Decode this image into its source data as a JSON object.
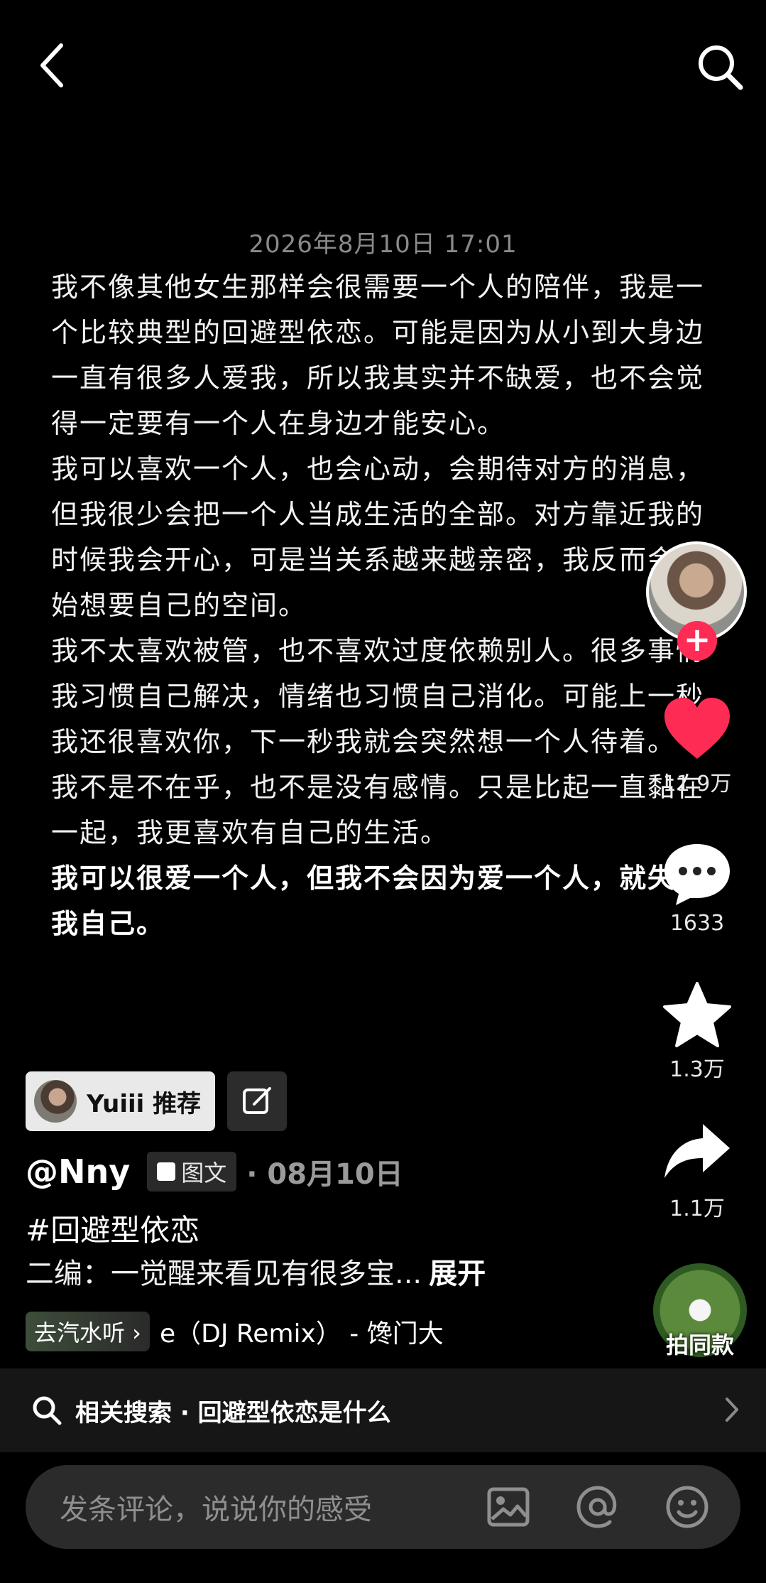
{
  "nav": {
    "back_icon": "chevron-left-icon",
    "search_icon": "search-icon"
  },
  "post": {
    "timestamp": "2026年8月10日 17:01",
    "paragraphs": [
      "我不像其他女生那样会很需要一个人的陪伴，我是一个比较典型的回避型依恋。可能是因为从小到大身边一直有很多人爱我，所以我其实并不缺爱，也不会觉得一定要有一个人在身边才能安心。",
      "我可以喜欢一个人，也会心动，会期待对方的消息，但我很少会把一个人当成生活的全部。对方靠近我的时候我会开心，可是当关系越来越亲密，我反而会开始想要自己的空间。",
      "我不太喜欢被管，也不喜欢过度依赖别人。很多事情我习惯自己解决，情绪也习惯自己消化。可能上一秒我还很喜欢你，下一秒我就会突然想一个人待着。",
      "我不是不在乎，也不是没有感情。只是比起一直黏在一起，我更喜欢有自己的生活。",
      "我可以很爱一个人，但我不会因为爱一个人，就失去我自己。"
    ]
  },
  "actions": {
    "follow_plus": "+",
    "likes": "11.9万",
    "comments": "1633",
    "favorites": "1.3万",
    "shares": "1.1万",
    "like_color": "#fe2c55"
  },
  "recommend": {
    "label": "Yuiii 推荐"
  },
  "author": {
    "username": "@Nny",
    "type_tag": "图文",
    "date": "· 08月10日"
  },
  "hashtag": "#回避型依恋",
  "caption": {
    "text": "二编：一觉醒来看见有很多宝...",
    "expand": "展开"
  },
  "music": {
    "pill": "去汽水听 ›",
    "title": "e（DJ Remix） - 馋门大"
  },
  "same_style": {
    "label": "拍同款"
  },
  "related_search": {
    "text": "相关搜索 · 回避型依恋是什么"
  },
  "comment": {
    "placeholder": "发条评论，说说你的感受"
  }
}
